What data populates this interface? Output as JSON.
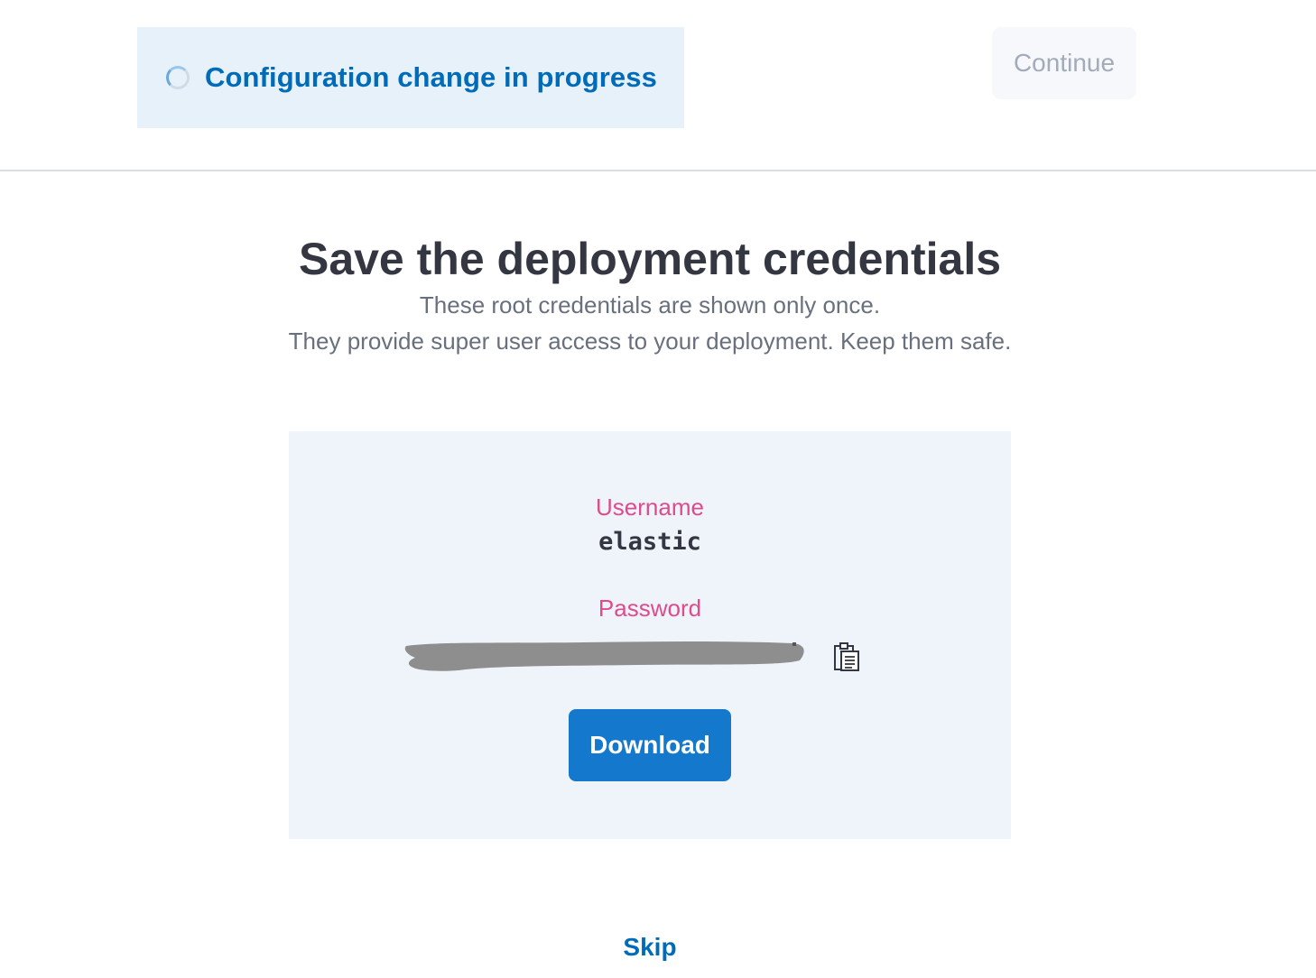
{
  "status": {
    "text": "Configuration change in progress",
    "icon": "loading-spinner-icon"
  },
  "header": {
    "continue_label": "Continue",
    "continue_disabled": true
  },
  "main": {
    "title": "Save the deployment credentials",
    "subtitle_line1": "These root credentials are shown only once.",
    "subtitle_line2": "They provide super user access to your deployment. Keep them safe."
  },
  "credentials": {
    "username_label": "Username",
    "username_value": "elastic",
    "password_label": "Password",
    "password_redacted": true,
    "copy_icon": "clipboard-icon",
    "download_label": "Download"
  },
  "footer": {
    "skip_label": "Skip"
  },
  "colors": {
    "accent": "#006bb8",
    "callout_bg": "#e6f1fa",
    "label_pink": "#dd4c8c",
    "panel_bg": "#eff3fa",
    "primary_button": "#1479cc",
    "redaction": "#8e8e8e"
  }
}
